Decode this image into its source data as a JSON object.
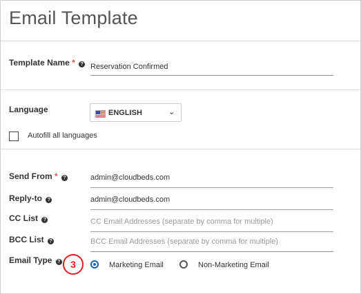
{
  "page": {
    "title": "Email Template"
  },
  "template_name": {
    "label": "Template Name",
    "required_marker": "*",
    "value": "Reservation Confirmed"
  },
  "language": {
    "label": "Language",
    "selected": "ENGLISH",
    "flag_icon": "us-flag-icon",
    "chevron": "⌄"
  },
  "autofill": {
    "label": "Autofill all languages",
    "checked": false
  },
  "send_from": {
    "label": "Send From",
    "required_marker": "*",
    "value": "admin@cloudbeds.com"
  },
  "reply_to": {
    "label": "Reply-to",
    "value": "admin@cloudbeds.com"
  },
  "cc_list": {
    "label": "CC List",
    "placeholder": "CC Email Addresses (separate by comma for multiple)"
  },
  "bcc_list": {
    "label": "BCC List",
    "placeholder": "BCC Email Addresses (separate by comma for multiple)"
  },
  "email_type": {
    "label": "Email Type",
    "options": [
      {
        "label": "Marketing Email",
        "selected": true
      },
      {
        "label": "Non-Marketing Email",
        "selected": false
      }
    ]
  },
  "step_badge": "3",
  "colors": {
    "required": "#d9534f",
    "radio_selected": "#1f5fa8",
    "badge": "#e02020"
  }
}
